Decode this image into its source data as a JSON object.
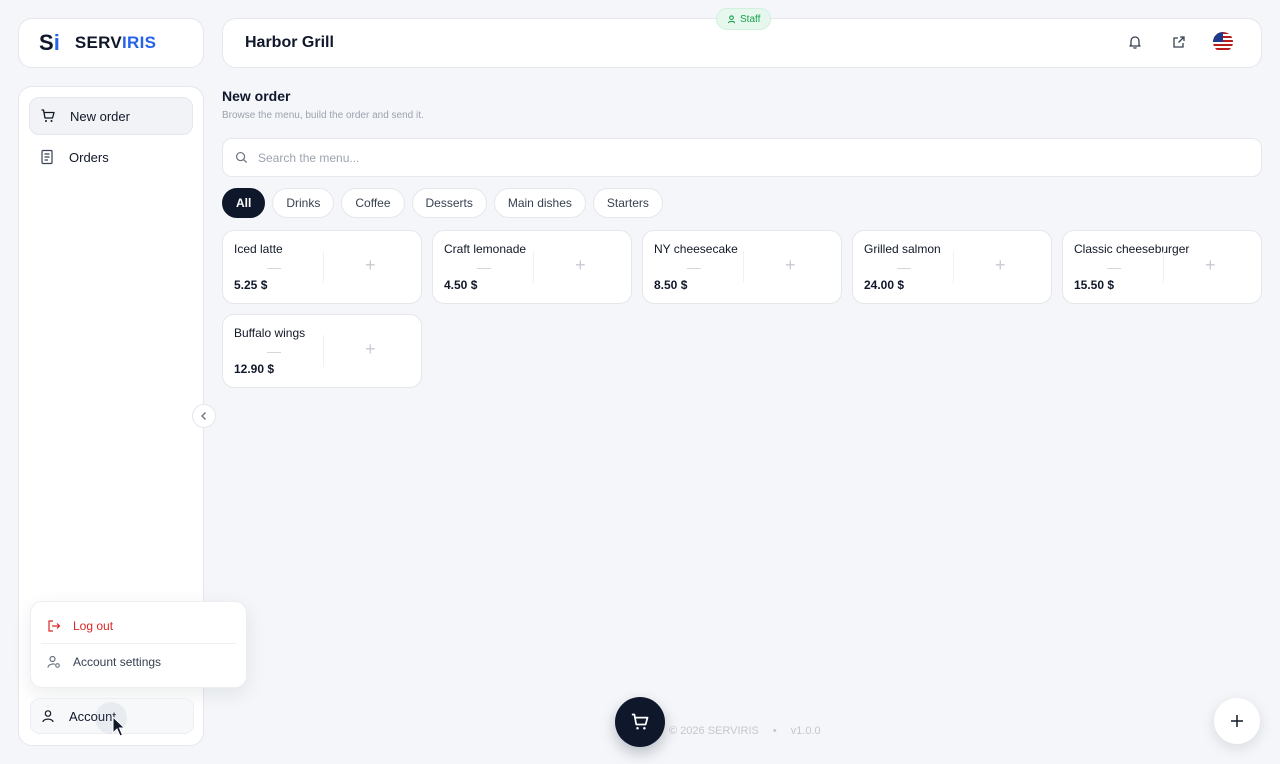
{
  "brand": {
    "mark_s": "S",
    "mark_i": "i",
    "name_a": "SERV",
    "name_b": "IRIS"
  },
  "header": {
    "title": "Harbor Grill",
    "badge": "Staff"
  },
  "header_icons": [
    "bell-icon",
    "external-link-icon",
    "us-flag-icon"
  ],
  "sidebar": {
    "items": [
      {
        "label": "New order",
        "icon": "cart-icon",
        "active": true
      },
      {
        "label": "Orders",
        "icon": "receipt-icon",
        "active": false
      }
    ],
    "account_label": "Account"
  },
  "account_menu": {
    "logout": "Log out",
    "settings": "Account settings"
  },
  "main": {
    "title": "New order",
    "subtitle": "Browse the menu, build the order and send it.",
    "search_placeholder": "Search the menu...",
    "categories": [
      "All",
      "Drinks",
      "Coffee",
      "Desserts",
      "Main dishes",
      "Starters"
    ],
    "selected_category": "All",
    "products": [
      {
        "name": "Iced latte",
        "price": "5.25 $"
      },
      {
        "name": "Craft lemonade",
        "price": "4.50 $"
      },
      {
        "name": "NY cheesecake",
        "price": "8.50 $"
      },
      {
        "name": "Grilled salmon",
        "price": "24.00 $"
      },
      {
        "name": "Classic cheeseburger",
        "price": "15.50 $"
      },
      {
        "name": "Buffalo wings",
        "price": "12.90 $"
      }
    ]
  },
  "footer": {
    "copyright": "© 2026 SERVIRIS",
    "sep": "•",
    "version": "v1.0.0"
  },
  "colors": {
    "accent": "#2563eb",
    "dark": "#0f172a",
    "danger": "#dc2626",
    "success": "#16a34a"
  }
}
